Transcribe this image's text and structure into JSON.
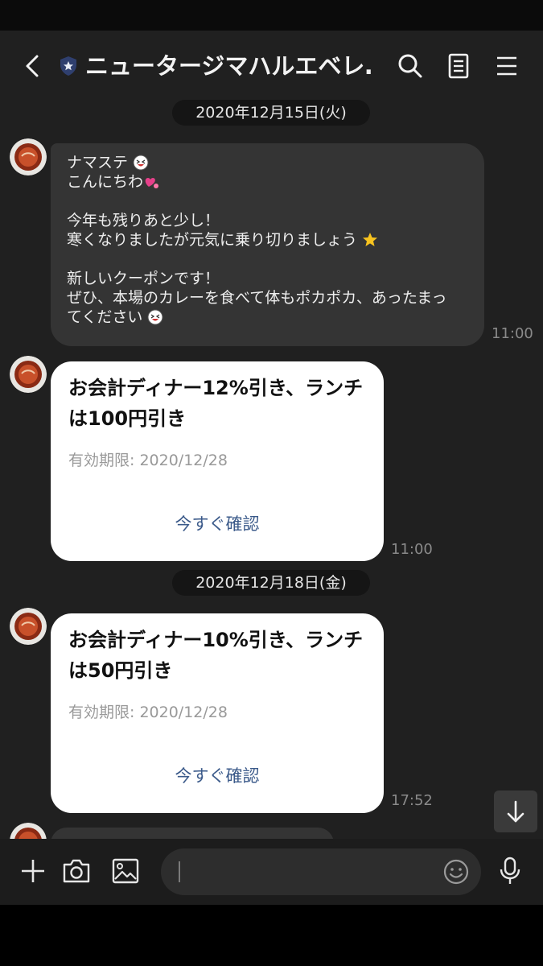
{
  "header": {
    "title": "ニュータージマハルエベレ…"
  },
  "messages": {
    "date1": "2020年12月15日(火)",
    "text_message": {
      "line1": "ナマステ",
      "line2": "こんにちわ",
      "line3": "今年も残りあと少し！",
      "line4": "寒くなりましたが元気に乗り切りましょう",
      "line5": "新しいクーポンです！",
      "line6": "ぜひ、本場のカレーを食べて体もポカポカ、あったまっ",
      "line7": "てください",
      "time": "11:00"
    },
    "coupon1": {
      "title": "お会計ディナー12%引き、ランチは100円引き",
      "expiry": "有効期限: 2020/12/28",
      "link": "今すぐ確認",
      "time": "11:00"
    },
    "date2": "2020年12月18日(金)",
    "coupon2": {
      "title": "お会計ディナー10%引き、ランチは50円引き",
      "expiry": "有効期限: 2020/12/28",
      "link": "今すぐ確認",
      "time": "17:52"
    }
  },
  "colors": {
    "chat_bg": "#202020",
    "bubble_bg": "#343434",
    "coupon_bg": "#ffffff",
    "link": "#3b5a8a"
  },
  "icons": [
    "back-arrow-icon",
    "shield-icon",
    "search-icon",
    "notes-icon",
    "menu-icon",
    "plus-icon",
    "camera-icon",
    "image-icon",
    "emoji-icon",
    "microphone-icon",
    "arrow-down-icon"
  ]
}
